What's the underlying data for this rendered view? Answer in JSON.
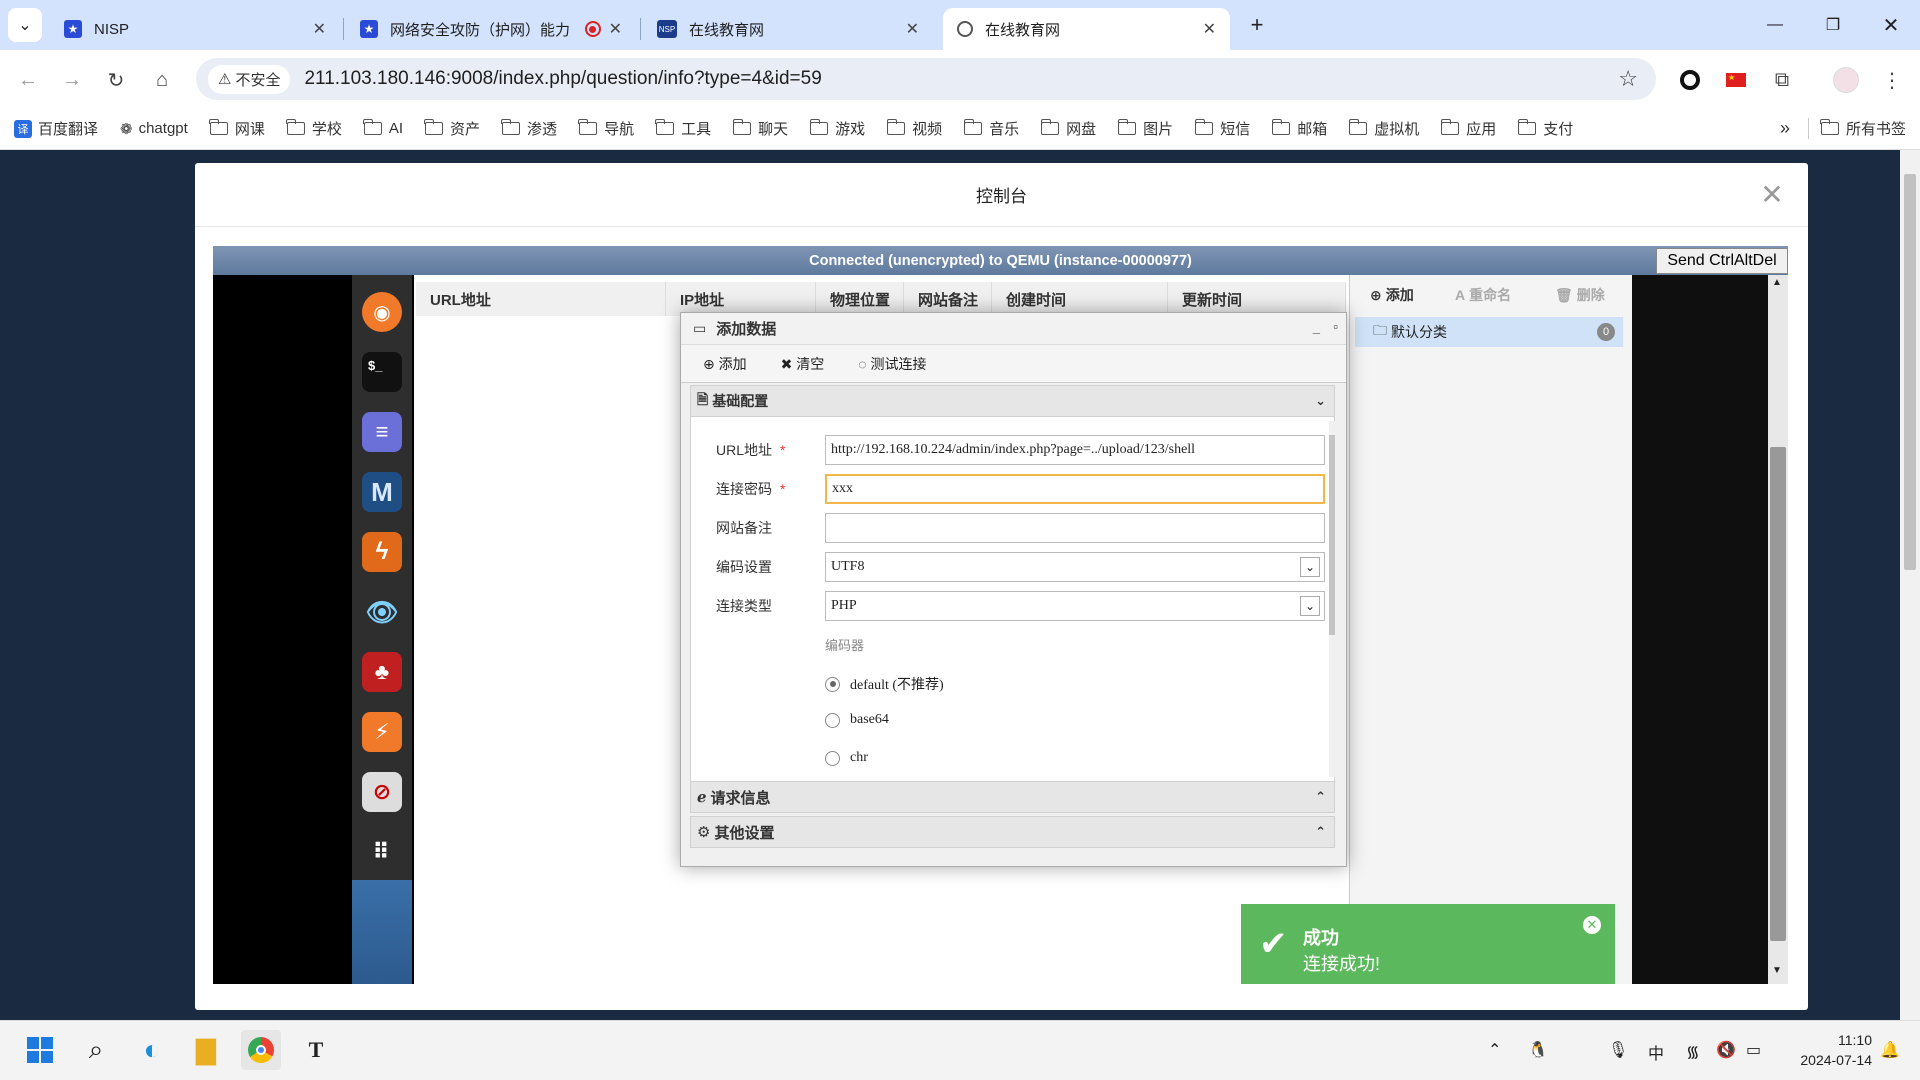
{
  "browser": {
    "tabs": [
      {
        "title": "NISP",
        "icon": "star-badge-icon"
      },
      {
        "title": "网络安全攻防（护网）能力",
        "icon": "star-badge-icon"
      },
      {
        "title": "在线教育网",
        "icon": "nisp-logo-icon"
      },
      {
        "title": "在线教育网",
        "icon": "globe-icon"
      }
    ],
    "security_label": "不安全",
    "url": "211.103.180.146:9008/index.php/question/info?type=4&id=59",
    "bookmarks": [
      "百度翻译",
      "chatgpt",
      "网课",
      "学校",
      "AI",
      "资产",
      "渗透",
      "导航",
      "工具",
      "聊天",
      "游戏",
      "视频",
      "音乐",
      "网盘",
      "图片",
      "短信",
      "邮箱",
      "虚拟机",
      "应用",
      "支付"
    ],
    "all_bookmarks": "所有书签"
  },
  "modal": {
    "title": "控制台",
    "vnc_status": "Connected (unencrypted) to QEMU (instance-00000977)",
    "send_ctrl_alt_del": "Send CtrlAltDel"
  },
  "app": {
    "columns": [
      "URL地址",
      "IP地址",
      "物理位置",
      "网站备注",
      "创建时间",
      "更新时间"
    ],
    "right_panel": {
      "add": "添加",
      "rename": "重命名",
      "delete": "删除",
      "category": "默认分类",
      "category_count": "0"
    },
    "dialog": {
      "title": "添加数据",
      "toolbar": {
        "add": "添加",
        "clear": "清空",
        "test": "测试连接"
      },
      "section_basic": "基础配置",
      "section_request": "请求信息",
      "section_other": "其他设置",
      "fields": {
        "url_label": "URL地址",
        "url_value": "http://192.168.10.224/admin/index.php?page=../upload/123/shell",
        "password_label": "连接密码",
        "password_value": "xxx",
        "note_label": "网站备注",
        "note_value": "",
        "encoding_label": "编码设置",
        "encoding_value": "UTF8",
        "type_label": "连接类型",
        "type_value": "PHP",
        "encoder_label": "编码器",
        "encoders": [
          "default (不推荐)",
          "base64",
          "chr"
        ],
        "encoder_selected": "default (不推荐)"
      }
    },
    "toast": {
      "title": "成功",
      "message": "连接成功!"
    }
  },
  "taskbar": {
    "ime": "中",
    "time": "11:10",
    "date": "2024-07-14"
  }
}
